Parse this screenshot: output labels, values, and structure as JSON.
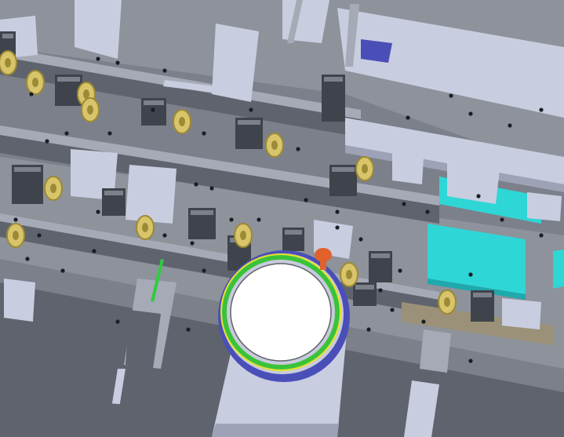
{
  "scene": {
    "colors": {
      "background": "#bfc3cf",
      "base_plate": "#8e929b",
      "rail_dark": "#5f636d",
      "rail_mid": "#7c808a",
      "rail_light": "#a6aab6",
      "bracket": "#c9cde0",
      "bracket_shadow": "#9ea2b6",
      "block_dark": "#3f434b",
      "gold_part": "#d8c46a",
      "gold_dark": "#9c8a34",
      "cyan_panel": "#2fd6d6",
      "cyan_dark": "#1fa9ad",
      "bowl_rim": "#4a4fb8",
      "bowl_green": "#3bc23b",
      "bowl_yellow": "#e6e22a",
      "bowl_inner": "#c8cbdc",
      "orange_knob": "#e0622a",
      "tan_bar": "#9b9178",
      "hole": "#1c1e24",
      "sensor_green": "#2ecc40"
    },
    "icons": [
      "vibratory-bowl-feeder",
      "orange-knob",
      "gold-terminal-part",
      "cyan-cover-panel",
      "linear-slide",
      "sensor-rod"
    ]
  }
}
